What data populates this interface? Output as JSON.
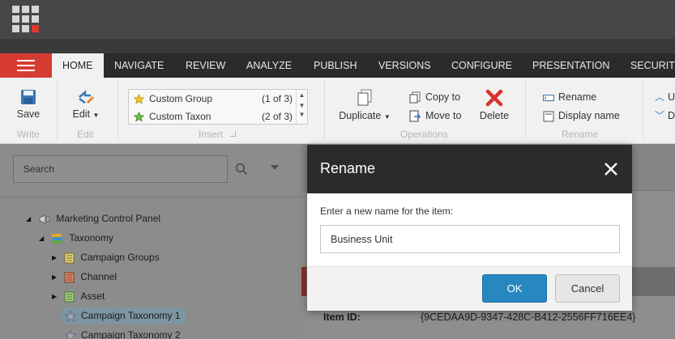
{
  "app": {
    "launcher_icon": "app-launcher-grid-icon",
    "accent": "#d63b32"
  },
  "ribbon_tabs": [
    {
      "label": "HOME",
      "active": true
    },
    {
      "label": "NAVIGATE"
    },
    {
      "label": "REVIEW"
    },
    {
      "label": "ANALYZE"
    },
    {
      "label": "PUBLISH"
    },
    {
      "label": "VERSIONS"
    },
    {
      "label": "CONFIGURE"
    },
    {
      "label": "PRESENTATION"
    },
    {
      "label": "SECURITY"
    }
  ],
  "ribbon": {
    "write": {
      "save_label": "Save",
      "group_label": "Write"
    },
    "edit": {
      "edit_label": "Edit",
      "group_label": "Edit"
    },
    "insert": {
      "group_label": "Insert",
      "items": [
        {
          "label": "Custom Group",
          "count": "(1 of 3)"
        },
        {
          "label": "Custom Taxon",
          "count": "(2 of 3)"
        }
      ]
    },
    "operations": {
      "duplicate_label": "Duplicate",
      "copy_to_label": "Copy to",
      "move_to_label": "Move to",
      "delete_label": "Delete",
      "group_label": "Operations"
    },
    "rename": {
      "rename_label": "Rename",
      "display_name_label": "Display name",
      "group_label": "Rename"
    },
    "sorting": {
      "up_label": "U",
      "down_label": "D"
    }
  },
  "search": {
    "placeholder": "Search"
  },
  "tree": [
    {
      "label": "Marketing Control Panel",
      "level": 0,
      "expanded": true
    },
    {
      "label": "Taxonomy",
      "level": 1,
      "expanded": true
    },
    {
      "label": "Campaign Groups",
      "level": 2
    },
    {
      "label": "Channel",
      "level": 2
    },
    {
      "label": "Asset",
      "level": 2
    },
    {
      "label": "Campaign Taxonomy 1",
      "level": 2,
      "selected": true
    },
    {
      "label": "Campaign Taxonomy 2",
      "level": 2
    }
  ],
  "item_info": {
    "item_id_label": "Item ID:",
    "item_id_value": "{9CEDAA9D-9347-428C-B412-2556FF716EE4}"
  },
  "dialog": {
    "title": "Rename",
    "prompt": "Enter a new name for the item:",
    "value": "Business Unit",
    "ok_label": "OK",
    "cancel_label": "Cancel"
  }
}
